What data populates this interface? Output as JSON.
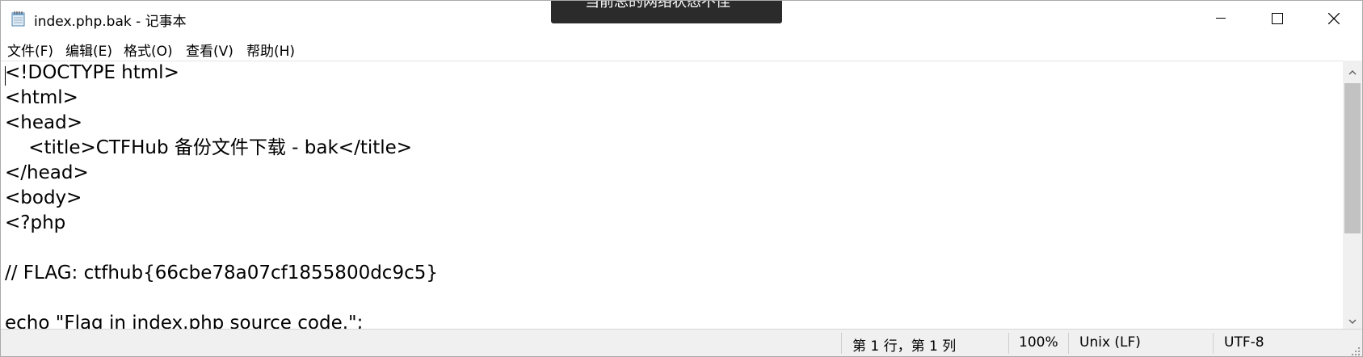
{
  "window": {
    "title": "index.php.bak - 记事本",
    "icon": "notepad-icon",
    "controls": {
      "minimize": "minimize-icon",
      "maximize": "maximize-icon",
      "close": "close-icon"
    }
  },
  "toast": {
    "text": "当前总的网络状态不佳"
  },
  "menu": {
    "items": [
      {
        "label": "文件(F)"
      },
      {
        "label": "编辑(E)"
      },
      {
        "label": "格式(O)"
      },
      {
        "label": "查看(V)"
      },
      {
        "label": "帮助(H)"
      }
    ]
  },
  "editor": {
    "lines": [
      "<!DOCTYPE html>",
      "<html>",
      "<head>",
      "    <title>CTFHub 备份文件下载 - bak</title>",
      "</head>",
      "<body>",
      "<?php",
      "",
      "// FLAG: ctfhub{66cbe78a07cf1855800dc9c5}",
      "",
      "echo \"Flag in index.php source code.\";"
    ]
  },
  "statusbar": {
    "position": "第 1 行，第 1 列",
    "zoom": "100%",
    "line_ending": "Unix (LF)",
    "encoding": "UTF-8"
  },
  "colors": {
    "toast_bg": "#2b2b2b",
    "statusbar_bg": "#f0f0f0",
    "scroll_thumb": "#c2c2c2"
  }
}
